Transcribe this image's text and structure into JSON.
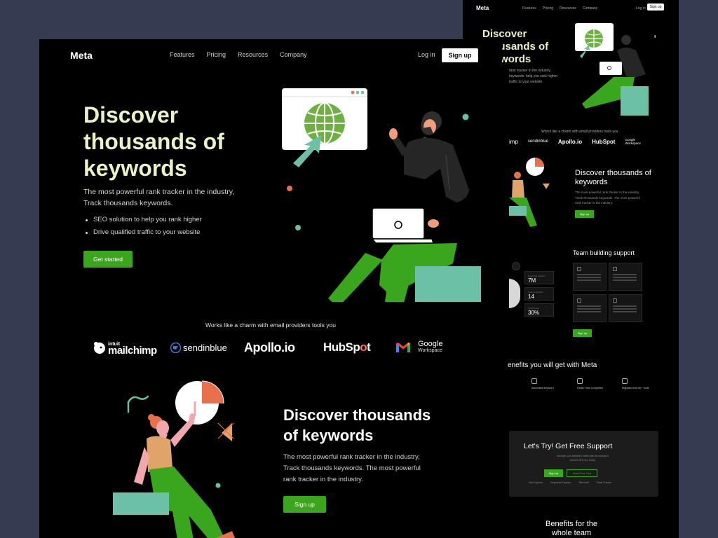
{
  "front": {
    "nav": {
      "logo": "Meta",
      "links": [
        "Features",
        "Pricing",
        "Resources",
        "Company"
      ],
      "login": "Log in",
      "signup": "Sign up"
    },
    "hero": {
      "title": "Discover thousands of keywords",
      "subtitle": "The most powerful rank tracker in the industry, Track thousands keywords.",
      "bullets": [
        "SEO solution to help you rank higher",
        "Drive qualified traffic to your website"
      ],
      "cta": "Get started"
    },
    "works_with": "Works like a charm with email providers tools you",
    "logos": {
      "mailchimp_top": "intuit",
      "mailchimp": "mailchimp",
      "sendinblue": "sendinblue",
      "apollo": "Apollo.io",
      "hubspot_a": "HubSp",
      "hubspot_o": "o",
      "hubspot_b": "t",
      "google": "Google",
      "google_sub": "Workspace"
    },
    "section2": {
      "title": "Discover thousands of keywords",
      "subtitle": "The most powerful rank tracker in the industry, Track thousands keywords. The most powerful rank tracker in the industry.",
      "cta": "Sign up"
    }
  },
  "back": {
    "nav": {
      "logo": "Meta",
      "links": [
        "Features",
        "Pricing",
        "Resources",
        "Company"
      ],
      "login": "Log in",
      "signup": "Sign up"
    },
    "hero_title": "Discover thousands of keywords",
    "hero_sub": "rank tracker in the industry, keywords. help you rank higher traffic to your website",
    "works_with": "Works like a charm with email providers tools you",
    "logos": [
      "imp",
      "sendinblue",
      "Apollo.io",
      "HubSpot",
      "Google Workspace"
    ],
    "section2": {
      "title": "Discover thousands of keywords",
      "subtitle": "The most powerful rank tracker in the industry, Track thousands keywords. The most powerful rank tracker in the industry.",
      "cta": "Sign up"
    },
    "team": {
      "title": "Team building support",
      "stats": [
        "7M",
        "14",
        "30%"
      ],
      "cta": "Sign up"
    },
    "benefits_title": "enefits you will get with Meta",
    "features": [
      "Automated Keyword",
      "Faster Than Competitor",
      "Migration from 60+ Tools"
    ],
    "cta_box": {
      "title": "Let's Try! Get Free Support",
      "subtitle": "Increase your website's traffic with the industry's favorite SEO tool today.",
      "primary": "Sign up",
      "secondary": "Start Free Trial",
      "items": [
        "Site Explorer",
        "Keywords Explorer",
        "Site Audit",
        "Rank Tracker"
      ]
    },
    "bottom_title": "Benefits for the whole team"
  },
  "colors": {
    "page_bg": "#363b52",
    "panel_bg": "#000000",
    "accent_green": "#3aa61d",
    "hero_title": "#e9f3c5",
    "teal": "#6cc0a6",
    "orange": "#e8704a"
  }
}
